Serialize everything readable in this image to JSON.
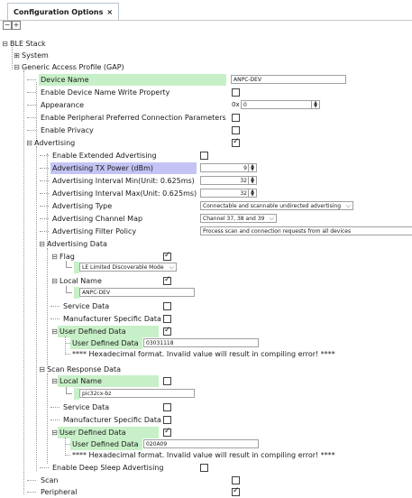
{
  "tab": {
    "title": "Configuration Options"
  },
  "toolbar": {
    "collapse": "−",
    "expand": "+"
  },
  "tree": {
    "ble_stack": "BLE Stack",
    "system": "System",
    "gap": "Generic Access Profile (GAP)",
    "device_name": {
      "label": "Device Name",
      "value": "ANPC-DEV"
    },
    "enable_device_name_write": "Enable Device Name Write Property",
    "appearance": {
      "label": "Appearance",
      "prefix": "0x",
      "value": "0"
    },
    "enable_ppcp": "Enable Peripheral Preferred Connection Parameters",
    "enable_privacy": "Enable Privacy",
    "advertising": "Advertising",
    "enable_ext_adv": "Enable Extended Advertising",
    "adv_tx_power": {
      "label": "Advertising TX Power (dBm)",
      "value": "9"
    },
    "adv_int_min": {
      "label": "Advertising Interval Min(Unit: 0.625ms)",
      "value": "32"
    },
    "adv_int_max": {
      "label": "Advertising Interval Max(Unit: 0.625ms)",
      "value": "32"
    },
    "adv_type": {
      "label": "Advertising Type",
      "value": "Connectable and scannable undirected advertising"
    },
    "adv_channel_map": {
      "label": "Advertising Channel Map",
      "value": "Channel 37, 38 and 39"
    },
    "adv_filter_policy": {
      "label": "Advertising Filter Policy",
      "value": "Process scan and connection requests from all devices"
    },
    "adv_data": "Advertising Data",
    "flag": {
      "label": "Flag",
      "value": "LE Limited Discoverable Mode"
    },
    "local_name": {
      "label": "Local Name",
      "value": "ANPC-DEV"
    },
    "service_data": "Service Data",
    "manufacturer_data": "Manufacturer Specific Data",
    "user_defined_data": "User Defined Data",
    "user_defined_data_child": {
      "label": "User Defined Data",
      "value": "03031118"
    },
    "warning": "**** Hexadecimal format. Invalid value will result in compiling error! ****",
    "scan_resp_data": "Scan Response Data",
    "sr_local_name": {
      "label": "Local Name",
      "value": "pic32cx-bz"
    },
    "sr_service_data": "Service Data",
    "sr_manufacturer_data": "Manufacturer Specific Data",
    "sr_user_defined_data": "User Defined Data",
    "sr_user_defined_data_child": {
      "label": "User Defined Data",
      "value": "020A09"
    },
    "sr_warning": "**** Hexadecimal format. Invalid value will result in compiling error! ****",
    "enable_deep_sleep_adv": "Enable Deep Sleep Advertising",
    "scan": "Scan",
    "peripheral": "Peripheral"
  },
  "colors": {
    "highlight_green": "#c8f0c8",
    "highlight_blue": "#c4c4f4",
    "tab_border": "#b8c4d4"
  }
}
